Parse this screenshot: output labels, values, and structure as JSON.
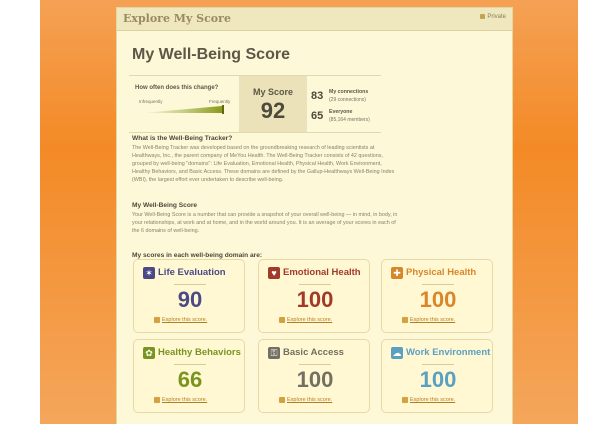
{
  "window": {
    "title": "Explore My Score",
    "privacy": "Private"
  },
  "page": {
    "title": "My Well-Being Score"
  },
  "stats": {
    "frequency_question": "How often does this change?",
    "frequency_low": "Infrequently",
    "frequency_high": "Frequently",
    "my_score_label": "My Score",
    "my_score_value": "92",
    "connections_value": "83",
    "connections_label": "My connections",
    "connections_sub": "(29 connections)",
    "everyone_value": "65",
    "everyone_label": "Everyone",
    "everyone_sub": "(85,164 members)"
  },
  "sections": [
    {
      "heading": "What is the Well-Being Tracker?",
      "body": "The Well-Being Tracker was developed based on the groundbreaking research of leading scientists at Healthways, Inc., the parent company of MeYou Health. The Well-Being Tracker consists of 42 questions, grouped by well-being \"domains\": Life Evaluation, Emotional Health, Physical Health, Work Environment, Healthy Behaviors, and Basic Access. These domains are defined by the Gallup-Healthways Well-Being Index (WBI), the largest effort ever undertaken to describe well-being."
    },
    {
      "heading": "My Well-Being Score",
      "body": "Your Well-Being Score is a number that can provide a snapshot of your overall well-being — in mind, in body, in your relationships, at work and at home, and in the world around you. It is an average of your scores in each of the 6 domains of well-being."
    }
  ],
  "scores_heading": "My scores in each well-being domain are:",
  "domains": [
    {
      "title": "Life Evaluation",
      "score": "90",
      "link": "Explore this score.",
      "icon": "life-evaluation-icon",
      "color": "#4b4a86"
    },
    {
      "title": "Emotional Health",
      "score": "100",
      "link": "Explore this score.",
      "icon": "emotional-health-icon",
      "color": "#a23a2a"
    },
    {
      "title": "Physical Health",
      "score": "100",
      "link": "Explore this score.",
      "icon": "physical-health-icon",
      "color": "#d9862b"
    },
    {
      "title": "Healthy Behaviors",
      "score": "66",
      "link": "Explore this score.",
      "icon": "healthy-behaviors-icon",
      "color": "#7a9420"
    },
    {
      "title": "Basic Access",
      "score": "100",
      "link": "Explore this score.",
      "icon": "basic-access-icon",
      "color": "#736f62"
    },
    {
      "title": "Work Environment",
      "score": "100",
      "link": "Explore this score.",
      "icon": "work-environment-icon",
      "color": "#5b9fc2"
    }
  ]
}
